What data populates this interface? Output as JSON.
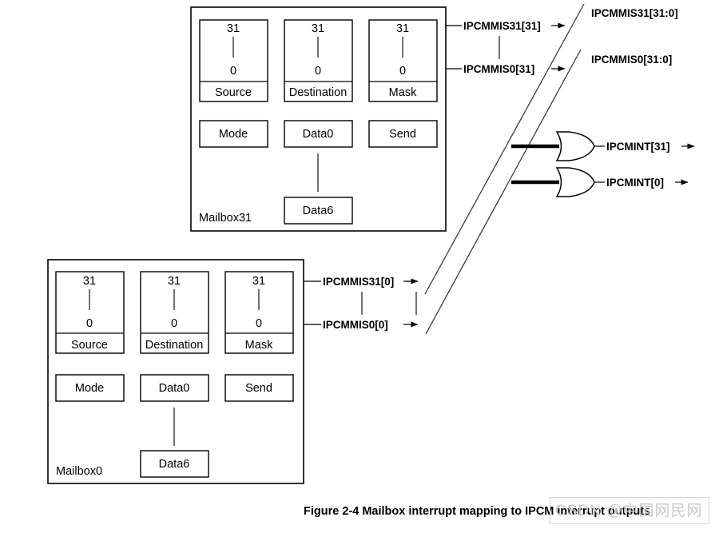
{
  "figure": {
    "caption": "Figure 2-4 Mailbox interrupt mapping to IPCM interrupt outputs",
    "watermark": "CSDN @中国网民网"
  },
  "mailboxes": [
    {
      "name": "Mailbox31",
      "registers": [
        {
          "msb": "31",
          "lsb": "0",
          "label": "Source"
        },
        {
          "msb": "31",
          "lsb": "0",
          "label": "Destination"
        },
        {
          "msb": "31",
          "lsb": "0",
          "label": "Mask"
        }
      ],
      "controls": [
        "Mode",
        "Data0",
        "Send"
      ],
      "data_last": "Data6"
    },
    {
      "name": "Mailbox0",
      "registers": [
        {
          "msb": "31",
          "lsb": "0",
          "label": "Source"
        },
        {
          "msb": "31",
          "lsb": "0",
          "label": "Destination"
        },
        {
          "msb": "31",
          "lsb": "0",
          "label": "Mask"
        }
      ],
      "controls": [
        "Mode",
        "Data0",
        "Send"
      ],
      "data_last": "Data6"
    }
  ],
  "signals": {
    "mailbox31_out": [
      "IPCMMIS31[31]",
      "IPCMMIS0[31]"
    ],
    "mailbox0_out": [
      "IPCMMIS31[0]",
      "IPCMMIS0[0]"
    ],
    "buses": [
      "IPCMMIS31[31:0]",
      "IPCMMIS0[31:0]"
    ],
    "interrupts": [
      "IPCMINT[31]",
      "IPCMINT[0]"
    ]
  },
  "gates": {
    "type": "OR",
    "count": 2
  },
  "colors": {
    "line": "#000000",
    "diagonal": "#3a3a3a",
    "background": "#ffffff",
    "watermark": "#c9c9c9"
  }
}
